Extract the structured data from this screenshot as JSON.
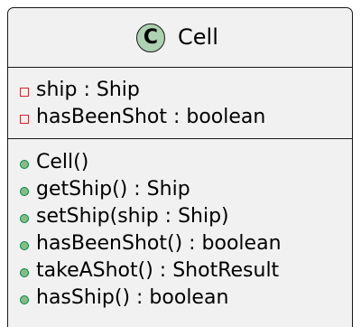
{
  "class": {
    "stereotype_letter": "C",
    "name": "Cell",
    "colors": {
      "background": "#f1f1f1",
      "border": "#181818",
      "stereotype_circle": "#add1b2",
      "private_marker": "#c82930",
      "public_marker": "#038048"
    },
    "fields": [
      {
        "visibility": "private",
        "text": "ship : Ship"
      },
      {
        "visibility": "private",
        "text": "hasBeenShot : boolean"
      }
    ],
    "methods": [
      {
        "visibility": "public",
        "text": "Cell()"
      },
      {
        "visibility": "public",
        "text": "getShip() : Ship"
      },
      {
        "visibility": "public",
        "text": "setShip(ship : Ship)"
      },
      {
        "visibility": "public",
        "text": "hasBeenShot() : boolean"
      },
      {
        "visibility": "public",
        "text": "takeAShot() : ShotResult"
      },
      {
        "visibility": "public",
        "text": "hasShip() : boolean"
      }
    ]
  }
}
